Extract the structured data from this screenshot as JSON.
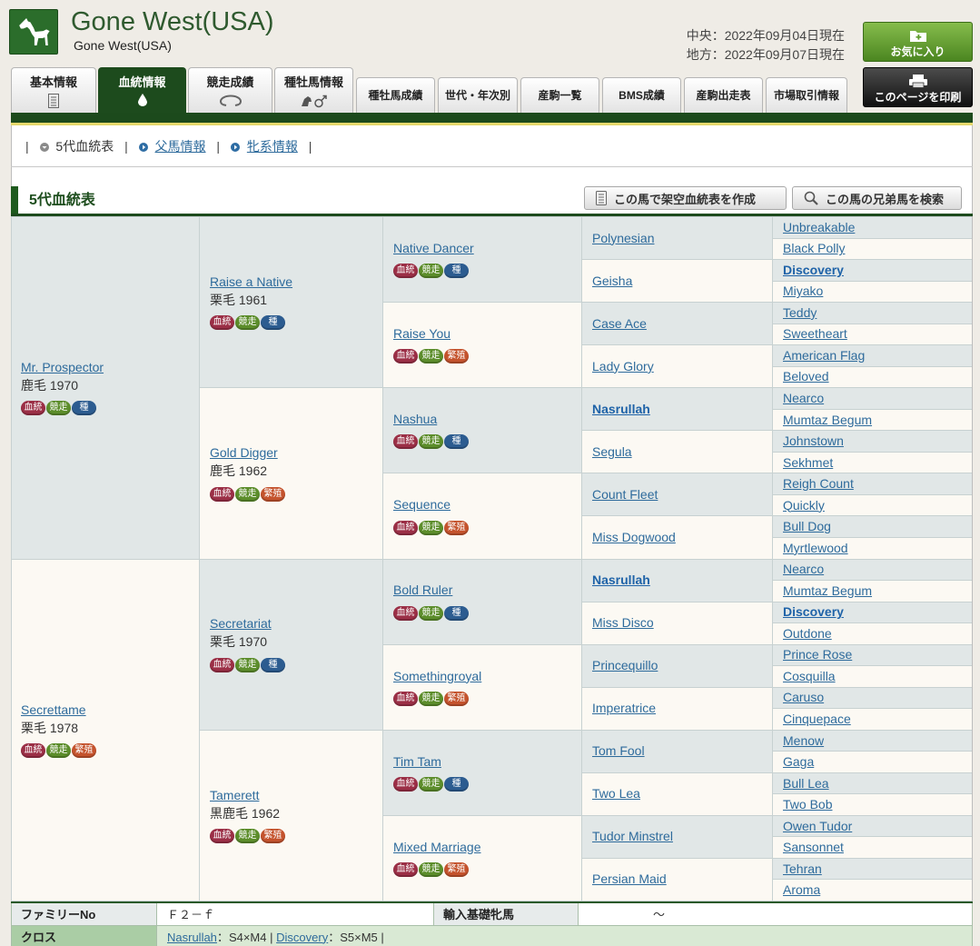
{
  "header": {
    "title": "Gone West(USA)",
    "subtitle": "Gone West(USA)",
    "dates": [
      "中央：2022年09月04日現在",
      "地方：2022年09月07日現在"
    ],
    "favorite_label": "お気に入り",
    "print_label": "このページを印刷"
  },
  "tabs": {
    "main": [
      "基本情報",
      "血統情報",
      "競走成績",
      "種牡馬情報"
    ],
    "sub": [
      "種牡馬成績",
      "世代・年次別",
      "産駒一覧",
      "BMS成績",
      "産駒出走表",
      "市場取引情報"
    ],
    "active_index": 1
  },
  "subnav": {
    "divider": "|",
    "current": "5代血統表",
    "links": [
      "父馬情報",
      "牝系情報"
    ]
  },
  "section": {
    "title": "5代血統表",
    "create_button": "この馬で架空血統表を作成",
    "siblings_button": "この馬の兄弟馬を検索"
  },
  "badge_labels": {
    "pedigree": "血統",
    "race": "競走",
    "sire": "種",
    "broodmare": "繁殖"
  },
  "badge_colors": {
    "pedigree": "#9b2f46",
    "race": "#5c8d2b",
    "sire": "#2c5c90",
    "broodmare": "#c4532d"
  },
  "colors": {
    "brand_green": "#1d4b1d",
    "sire_cell": "#e1e7e7",
    "dam_cell": "#fcf9f3"
  },
  "pedigree": {
    "gen1": [
      {
        "name": "Mr. Prospector",
        "coat": "鹿毛",
        "year": "1970",
        "badges": [
          "pedigree",
          "race",
          "sire"
        ]
      },
      {
        "name": "Secrettame",
        "coat": "栗毛",
        "year": "1978",
        "badges": [
          "pedigree",
          "race",
          "broodmare"
        ]
      }
    ],
    "gen2": [
      {
        "name": "Raise a Native",
        "coat": "栗毛",
        "year": "1961",
        "badges": [
          "pedigree",
          "race",
          "sire"
        ]
      },
      {
        "name": "Gold Digger",
        "coat": "鹿毛",
        "year": "1962",
        "badges": [
          "pedigree",
          "race",
          "broodmare"
        ]
      },
      {
        "name": "Secretariat",
        "coat": "栗毛",
        "year": "1970",
        "badges": [
          "pedigree",
          "race",
          "sire"
        ]
      },
      {
        "name": "Tamerett",
        "coat": "黒鹿毛",
        "year": "1962",
        "badges": [
          "pedigree",
          "race",
          "broodmare"
        ]
      }
    ],
    "gen3": [
      {
        "name": "Native Dancer",
        "badges": [
          "pedigree",
          "race",
          "sire"
        ]
      },
      {
        "name": "Raise You",
        "badges": [
          "pedigree",
          "race",
          "broodmare"
        ]
      },
      {
        "name": "Nashua",
        "badges": [
          "pedigree",
          "race",
          "sire"
        ]
      },
      {
        "name": "Sequence",
        "badges": [
          "pedigree",
          "race",
          "broodmare"
        ]
      },
      {
        "name": "Bold Ruler",
        "badges": [
          "pedigree",
          "race",
          "sire"
        ]
      },
      {
        "name": "Somethingroyal",
        "badges": [
          "pedigree",
          "race",
          "broodmare"
        ]
      },
      {
        "name": "Tim Tam",
        "badges": [
          "pedigree",
          "race",
          "sire"
        ]
      },
      {
        "name": "Mixed Marriage",
        "badges": [
          "pedigree",
          "race",
          "broodmare"
        ]
      }
    ],
    "gen4": [
      {
        "name": "Polynesian"
      },
      {
        "name": "Geisha"
      },
      {
        "name": "Case Ace"
      },
      {
        "name": "Lady Glory"
      },
      {
        "name": "Nasrullah",
        "bold": true
      },
      {
        "name": "Segula"
      },
      {
        "name": "Count Fleet"
      },
      {
        "name": "Miss Dogwood"
      },
      {
        "name": "Nasrullah",
        "bold": true
      },
      {
        "name": "Miss Disco"
      },
      {
        "name": "Princequillo"
      },
      {
        "name": "Imperatrice"
      },
      {
        "name": "Tom Fool"
      },
      {
        "name": "Two Lea"
      },
      {
        "name": "Tudor Minstrel"
      },
      {
        "name": "Persian Maid"
      }
    ],
    "gen5": [
      {
        "name": "Unbreakable"
      },
      {
        "name": "Black Polly"
      },
      {
        "name": "Discovery",
        "bold": true
      },
      {
        "name": "Miyako"
      },
      {
        "name": "Teddy"
      },
      {
        "name": "Sweetheart"
      },
      {
        "name": "American Flag"
      },
      {
        "name": "Beloved"
      },
      {
        "name": "Nearco"
      },
      {
        "name": "Mumtaz Begum"
      },
      {
        "name": "Johnstown"
      },
      {
        "name": "Sekhmet"
      },
      {
        "name": "Reigh Count"
      },
      {
        "name": "Quickly"
      },
      {
        "name": "Bull Dog"
      },
      {
        "name": "Myrtlewood"
      },
      {
        "name": "Nearco"
      },
      {
        "name": "Mumtaz Begum"
      },
      {
        "name": "Discovery",
        "bold": true
      },
      {
        "name": "Outdone"
      },
      {
        "name": "Prince Rose"
      },
      {
        "name": "Cosquilla"
      },
      {
        "name": "Caruso"
      },
      {
        "name": "Cinquepace"
      },
      {
        "name": "Menow"
      },
      {
        "name": "Gaga"
      },
      {
        "name": "Bull Lea"
      },
      {
        "name": "Two Bob"
      },
      {
        "name": "Owen Tudor"
      },
      {
        "name": "Sansonnet"
      },
      {
        "name": "Tehran"
      },
      {
        "name": "Aroma"
      }
    ]
  },
  "info": {
    "family_label": "ファミリーNo",
    "family_value": "Ｆ２－ｆ",
    "import_label": "輸入基礎牝馬",
    "import_value": "～",
    "cross_label": "クロス",
    "cross_separator": "：",
    "divider": "|",
    "crosses": [
      {
        "name": "Nasrullah",
        "value": "S4×M4"
      },
      {
        "name": "Discovery",
        "value": "S5×M5"
      }
    ]
  }
}
